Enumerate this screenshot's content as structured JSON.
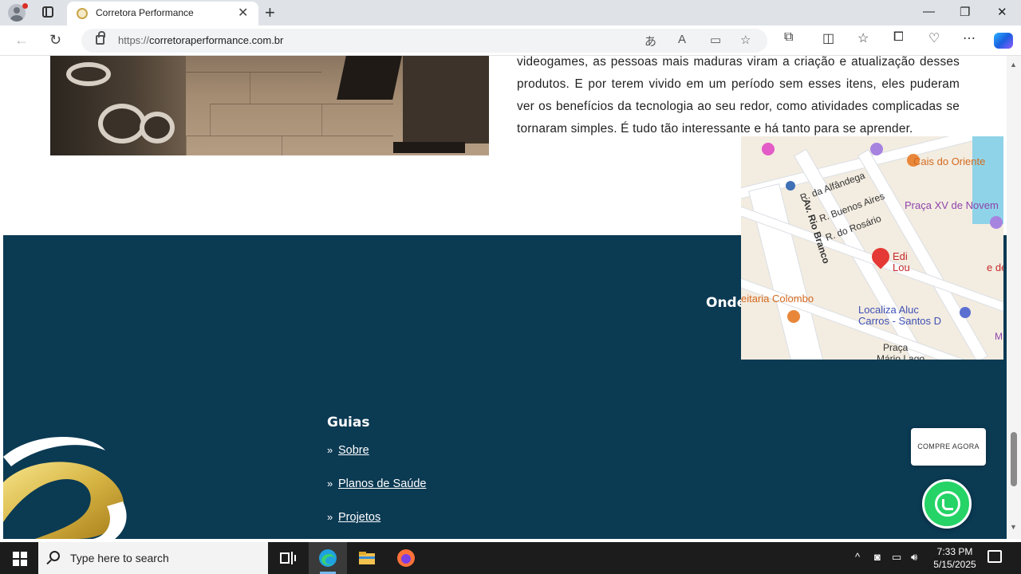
{
  "browser": {
    "tab_title": "Corretora Performance",
    "url_protocol": "https://",
    "url_domain": "corretoraperformance.com.br",
    "new_tab_symbol": "+",
    "tab_close_symbol": "✕",
    "minimize_symbol": "—",
    "maximize_symbol": "❐",
    "close_symbol": "✕"
  },
  "article": {
    "text": "videogames, as pessoas mais maduras viram a criação e atualização desses produtos. E por terem vivido em um período sem esses itens, eles puderam ver os benefícios da tecnologia ao seu redor, como atividades complicadas se tornaram simples. É tudo tão interessante e há tanto para se aprender."
  },
  "footer": {
    "guides_heading": "Guias",
    "guides": [
      {
        "label": "Sobre"
      },
      {
        "label": "Planos de Saúde"
      },
      {
        "label": "Projetos"
      }
    ],
    "location_heading": "Onde Estamos",
    "map_labels": {
      "cais": "Cais do Oriente",
      "alfandega": "R. da Alfândega",
      "buenos_aires": "R. Buenos Aires",
      "rosario": "R. do Rosário",
      "rio_branco": "Av. Rio Branco",
      "praca_xv": "Praça XV de Novem",
      "edificio": "Edi",
      "edificio2": "Lou",
      "edificio3": "e de",
      "colombo": "eitaria Colombo",
      "localiza": "Localiza Aluc",
      "localiza2": "Carros - Santos D",
      "praca_mario": "Praça",
      "praca_mario2": "Mário Lago",
      "m_edge": "M"
    }
  },
  "floating": {
    "buy_label": "COMPRE AGORA"
  },
  "taskbar": {
    "search_placeholder": "Type here to search",
    "time": "7:33 PM",
    "date": "5/15/2025"
  }
}
